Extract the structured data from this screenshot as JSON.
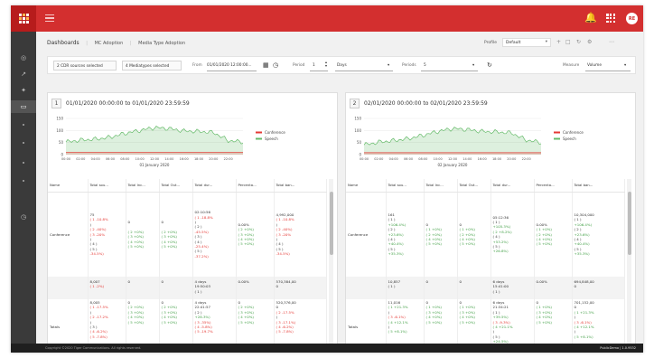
{
  "app": {
    "avatar_initials": "RE",
    "accent_color": "#d32f2f"
  },
  "breadcrumb": {
    "items": [
      "Dashboards",
      "MC Adoption",
      "Media Type Adoption"
    ]
  },
  "toolbar": {
    "profile_label": "Profile",
    "profile_value": "Default"
  },
  "filters": {
    "cdr_sources": "2 CDR sources selected",
    "media_types": "4 Mediatypes selected",
    "from_label": "From",
    "from_value": "01/01/2020 12:00:00...",
    "period_label": "Period",
    "period_value": "1",
    "period_unit": "Days",
    "periods_label": "Periods",
    "periods_value": "5",
    "measure_label": "Measure",
    "measure_value": "Volume"
  },
  "panels": [
    {
      "number": "1",
      "title": "01/01/2020 00:00:00 to 01/01/2020 23:59:59",
      "chart_data": {
        "type": "area",
        "title": "",
        "xlabel": "01 January 2020",
        "ylabel": "",
        "ylim": [
          0,
          150
        ],
        "y_ticks": [
          "150",
          "100",
          "50",
          "0"
        ],
        "x_ticks": [
          "00:00",
          "02:00",
          "04:00",
          "06:00",
          "08:00",
          "10:00",
          "12:00",
          "14:00",
          "16:00",
          "18:00",
          "20:00",
          "22:00"
        ],
        "x": [
          "00:00",
          "02:00",
          "04:00",
          "06:00",
          "08:00",
          "10:00",
          "12:00",
          "14:00",
          "16:00",
          "18:00",
          "20:00",
          "22:00",
          "24:00"
        ],
        "series": [
          {
            "name": "Conference",
            "color": "#e53935",
            "values": [
              10,
              10,
              10,
              10,
              10,
              10,
              10,
              10,
              10,
              10,
              10,
              10,
              10
            ]
          },
          {
            "name": "Speech",
            "color": "#66bb6a",
            "values": [
              52,
              60,
              64,
              72,
              88,
              100,
              112,
              108,
              98,
              96,
              92,
              58,
              52
            ]
          }
        ],
        "legend": "right",
        "grid": true
      },
      "table": {
        "headers": [
          "Name",
          "Total sou...",
          "Total Inc...",
          "Total Out...",
          "Total dur...",
          "Percenta...",
          "Total ban..."
        ],
        "rows": [
          {
            "name": "Conference",
            "cells": [
              "75\n( 1 -10.8%\n)\n( 2 -40%)\n( 3 -20%\n)\n( 4 )\n( 5 )\n-34.5%)",
              "0\n\n( 2 +0%)\n( 3 +0%)\n( 4 +0%)\n( 5 +0%)",
              "0\n\n( 2 +0%)\n( 3 +0%)\n( 4 +0%)\n( 5 +0%)",
              "02:10:56\n( 1 -18.8%\n)\n( 2 )\n-45.5%)\n( 3 )\n( 4 )\n-25.4%)\n( 5 )\n-37.2%)",
              "0.00%\n( 2 +0%)\n( 3 +0%)\n( 4 +0%)\n( 5 +0%)",
              "4,992,000\n( 1 -10.8%\n)\n( 2 -40%)\n( 3 -20%\n)\n( 4 )\n( 5 )\n-34.5%)"
            ]
          },
          {
            "name": "",
            "cells": [
              "8,007\n( 1 -2%)",
              "0",
              "0",
              "4 days\n19:50:03\n( 1 )",
              "0.00%",
              "570,384,00\n0"
            ]
          },
          {
            "name": "Totals",
            "cells": [
              "8,005\n( 1 -17.5%\n)\n( 2 -17.2%\n)\n( 3 )\n( 4 -6.2%)\n( 5 -7.8%)",
              "0\n( 2 +0%)\n( 3 +0%)\n( 4 +0%)\n( 5 +0%)",
              "0\n( 2 +0%)\n( 3 +0%)\n( 4 +0%)\n( 5 +0%)",
              "4 days\n22:41:57\n( 2 )\n+28.3%)\n( 3 -35%)\n( 4 -5.8%)\n( 5 -19.7%",
              "0\n( 2 +0%)\n( 3 +0%)\n( 4 +0%)\n( 5 +0%)",
              "520,376,00\n0\n( 2 -17.5%\n)\n( 3 -17.1%)\n( 4 -6.2%)\n( 5 -7.8%)"
            ]
          }
        ]
      }
    },
    {
      "number": "2",
      "title": "02/01/2020 00:00:00 to 02/01/2020 23:59:59",
      "chart_data": {
        "type": "area",
        "title": "",
        "xlabel": "02 January 2020",
        "ylabel": "",
        "ylim": [
          0,
          150
        ],
        "y_ticks": [
          "150",
          "100",
          "50",
          "0"
        ],
        "x_ticks": [
          "00:00",
          "02:00",
          "04:00",
          "06:00",
          "08:00",
          "10:00",
          "12:00",
          "14:00",
          "16:00",
          "18:00",
          "20:00",
          "22:00"
        ],
        "x": [
          "00:00",
          "02:00",
          "04:00",
          "06:00",
          "08:00",
          "10:00",
          "12:00",
          "14:00",
          "16:00",
          "18:00",
          "20:00",
          "22:00",
          "24:00"
        ],
        "series": [
          {
            "name": "Conference",
            "color": "#e53935",
            "values": [
              8,
              8,
              8,
              8,
              8,
              8,
              8,
              8,
              8,
              8,
              8,
              8,
              8
            ]
          },
          {
            "name": "Speech",
            "color": "#66bb6a",
            "values": [
              40,
              52,
              58,
              66,
              80,
              96,
              108,
              104,
              96,
              94,
              90,
              60,
              50
            ]
          }
        ],
        "legend": "right",
        "grid": true
      },
      "table": {
        "headers": [
          "Name",
          "Total sou...",
          "Total Inc...",
          "Total Out...",
          "Total dur...",
          "Percenta...",
          "Total ban..."
        ],
        "rows": [
          {
            "name": "Conference",
            "cells": [
              "161\n( 1 )\n+106.4%)\n( 2 )\n+23.6%)\n( 4 )\n+40.4%)\n( 5 )\n+35.3%)",
              "0\n( 1 +0%)\n( 2 +0%)\n( 4 +0%)\n( 5 +0%)",
              "0\n( 1 +0%)\n( 2 +0%)\n( 4 +0%)\n( 5 +0%)",
              "05:12:36\n( 1 )\n+105.3%)\n( 2 +8.2%)\n( 4 )\n+53.2%)\n( 5 )\n+26.8%)",
              "0.00%\n( 1 +0%)\n( 2 +0%)\n( 4 +0%)\n( 5 +0%)",
              "10,304,000\n( 1 )\n+106.4%)\n( 2 )\n+23.6%)\n( 4 )\n+40.4%)\n( 5 )\n+35.3%)"
            ]
          },
          {
            "name": "",
            "cells": [
              "10,857\n( 1 )",
              "0",
              "0",
              "6 days\n15:41:00\n( 1 )",
              "0.00%",
              "694,848,00\n0"
            ]
          },
          {
            "name": "Totals",
            "cells": [
              "11,016\n( 1 +21.3%\n)\n( 3 -6.1%)\n( 4 +12.1%\n)\n( 5 +8.1%)",
              "0\n( 1 +0%)\n( 3 +0%)\n( 4 +0%)\n( 5 +0%)",
              "0\n( 1 +0%)\n( 3 +0%)\n( 4 +0%)\n( 5 +0%)",
              "6 days\n21:34:21\n( 1 )\n+39.5%)\n( 3 -9.3%)\n( 4 +21.1%\n)\n( 5 )\n+24.5%)",
              "0\n( 1 +0%)\n( 3 +0%)\n( 4 +0%)\n( 5 +0%)",
              "701,152,00\n0\n( 1 +21.3%\n)\n( 3 -6.1%)\n( 4 +12.1%\n)\n( 5 +8.1%)"
            ]
          }
        ]
      }
    }
  ],
  "footer": {
    "copyright": "Copyright ©2020 Tiger Communications. All rights reserved.",
    "version": "PublicDemo | 1.0.9532"
  }
}
